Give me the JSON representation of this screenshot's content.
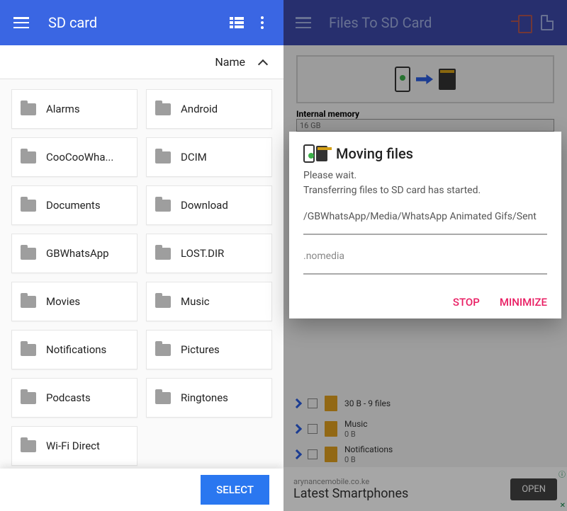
{
  "left": {
    "title": "SD card",
    "sort_label": "Name",
    "folders": [
      "Alarms",
      "Android",
      "CooCooWha...",
      "DCIM",
      "Documents",
      "Download",
      "GBWhatsApp",
      "LOST.DIR",
      "Movies",
      "Music",
      "Notifications",
      "Pictures",
      "Podcasts",
      "Ringtones",
      "Wi-Fi Direct"
    ],
    "select_label": "SELECT"
  },
  "right": {
    "title": "Files To SD Card",
    "mem_label": "Internal memory",
    "mem_value": "16 GB",
    "bg_rows": [
      {
        "name": "30 B - 9 files",
        "sub": ""
      },
      {
        "name": "Music",
        "sub": "0 B"
      },
      {
        "name": "Notifications",
        "sub": "0 B"
      }
    ],
    "ad": {
      "domain": "arynancemobile.co.ke",
      "headline": "Latest Smartphones",
      "open": "OPEN",
      "badge": "ⓘ",
      "close": "✕"
    }
  },
  "dialog": {
    "title": "Moving files",
    "line1": "Please wait.",
    "line2": "Transferring files to SD card has started.",
    "path": "/GBWhatsApp/Media/WhatsApp Animated Gifs/Sent",
    "file": ".nomedia",
    "stop": "STOP",
    "minimize": "MINIMIZE"
  }
}
